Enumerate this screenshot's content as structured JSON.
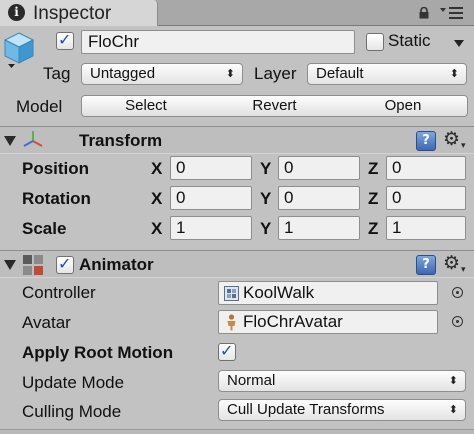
{
  "tab": {
    "icon": "info-icon",
    "title": "Inspector"
  },
  "header": {
    "object_icon": "cube-icon",
    "active": true,
    "name": "FloChr",
    "static_label": "Static",
    "static": false,
    "tag_label": "Tag",
    "tag_value": "Untagged",
    "layer_label": "Layer",
    "layer_value": "Default",
    "model_label": "Model",
    "model_buttons": [
      "Select",
      "Revert",
      "Open"
    ]
  },
  "transform": {
    "title": "Transform",
    "help": "?",
    "rows": [
      {
        "label": "Position",
        "x": "0",
        "y": "0",
        "z": "0"
      },
      {
        "label": "Rotation",
        "x": "0",
        "y": "0",
        "z": "0"
      },
      {
        "label": "Scale",
        "x": "1",
        "y": "1",
        "z": "1"
      }
    ],
    "axis": {
      "x": "X",
      "y": "Y",
      "z": "Z"
    }
  },
  "animator": {
    "title": "Animator",
    "enabled": true,
    "help": "?",
    "controller_label": "Controller",
    "controller_value": "KoolWalk",
    "avatar_label": "Avatar",
    "avatar_value": "FloChrAvatar",
    "apply_root_motion_label": "Apply Root Motion",
    "apply_root_motion": true,
    "update_mode_label": "Update Mode",
    "update_mode_value": "Normal",
    "culling_mode_label": "Culling Mode",
    "culling_mode_value": "Cull Update Transforms"
  },
  "colors": {
    "panel": "#c2c2c2",
    "field": "#f0f0f0",
    "check": "#1e4fa0",
    "help": "#3c68b0"
  }
}
